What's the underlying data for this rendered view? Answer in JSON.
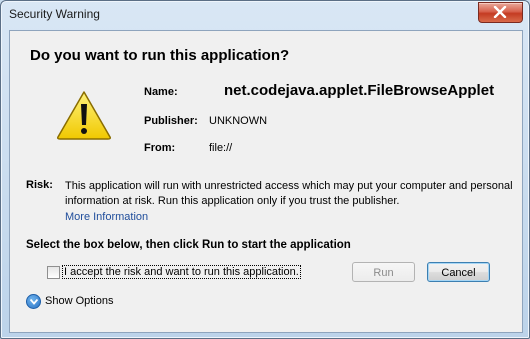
{
  "window": {
    "title": "Security Warning"
  },
  "dialog": {
    "heading": "Do you want to run this application?",
    "name_label": "Name:",
    "name_value": "net.codejava.applet.FileBrowseApplet",
    "publisher_label": "Publisher:",
    "publisher_value": "UNKNOWN",
    "from_label": "From:",
    "from_value": "file://",
    "risk_label": "Risk:",
    "risk_text": "This application will run with unrestricted access which may put your computer and personal information at risk. Run this application only if you trust the publisher.",
    "more_info": "More Information",
    "instruction": "Select the box below, then click Run to start the application",
    "accept_label": "I accept the risk and want to run this application.",
    "run_label": "Run",
    "cancel_label": "Cancel",
    "show_options": "Show Options"
  },
  "icons": {
    "warning": "warning-triangle-icon",
    "close": "close-icon",
    "expand": "chevron-down-icon"
  },
  "colors": {
    "link": "#1f4d9b",
    "close_button": "#c43b22",
    "warning_fill": "#f5d800"
  }
}
